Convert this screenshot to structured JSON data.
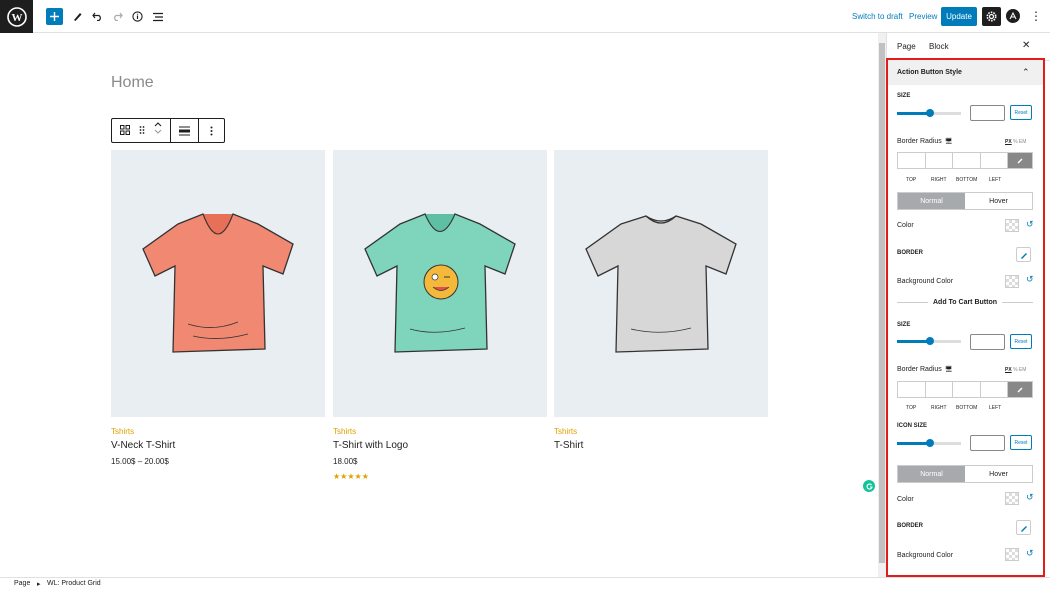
{
  "toolbar": {
    "switch_to_draft": "Switch to draft",
    "preview": "Preview",
    "update": "Update"
  },
  "canvas": {
    "page_title": "Home",
    "products": [
      {
        "category": "Tshirts",
        "name": "V-Neck T-Shirt",
        "price": "15.00$ – 20.00$",
        "stars": "",
        "shirt_color": "#f08872"
      },
      {
        "category": "Tshirts",
        "name": "T-Shirt with Logo",
        "price": "18.00$",
        "stars": "★★★★★",
        "shirt_color": "#7fd4bc"
      },
      {
        "category": "Tshirts",
        "name": "T-Shirt",
        "price": "",
        "stars": "",
        "shirt_color": "#d7d7d7"
      }
    ]
  },
  "sidebar": {
    "tabs": [
      "Page",
      "Block"
    ],
    "panel_title": "Action Button Style",
    "action": {
      "size_label": "SIZE",
      "reset": "Reset",
      "border_radius_label": "Border Radius",
      "units": [
        "PX",
        "%",
        "EM"
      ],
      "sides": [
        "TOP",
        "RIGHT",
        "BOTTOM",
        "LEFT"
      ],
      "normal": "Normal",
      "hover": "Hover",
      "color_label": "Color",
      "border_label": "BORDER",
      "bg_label": "Background Color"
    },
    "cart_title": "Add To Cart Button",
    "cart": {
      "size_label": "SIZE",
      "reset": "Reset",
      "border_radius_label": "Border Radius",
      "units": [
        "PX",
        "%",
        "EM"
      ],
      "sides": [
        "TOP",
        "RIGHT",
        "BOTTOM",
        "LEFT"
      ],
      "icon_size_label": "ICON SIZE",
      "reset2": "Reset",
      "normal": "Normal",
      "hover": "Hover",
      "color_label": "Color",
      "border_label": "BORDER",
      "bg_label": "Background Color"
    }
  },
  "footer": {
    "crumb1": "Page",
    "crumb2": "WL: Product Grid"
  },
  "colors": {
    "accent": "#007cba",
    "highlight_frame": "#e31b1b",
    "category": "#e0a100"
  }
}
